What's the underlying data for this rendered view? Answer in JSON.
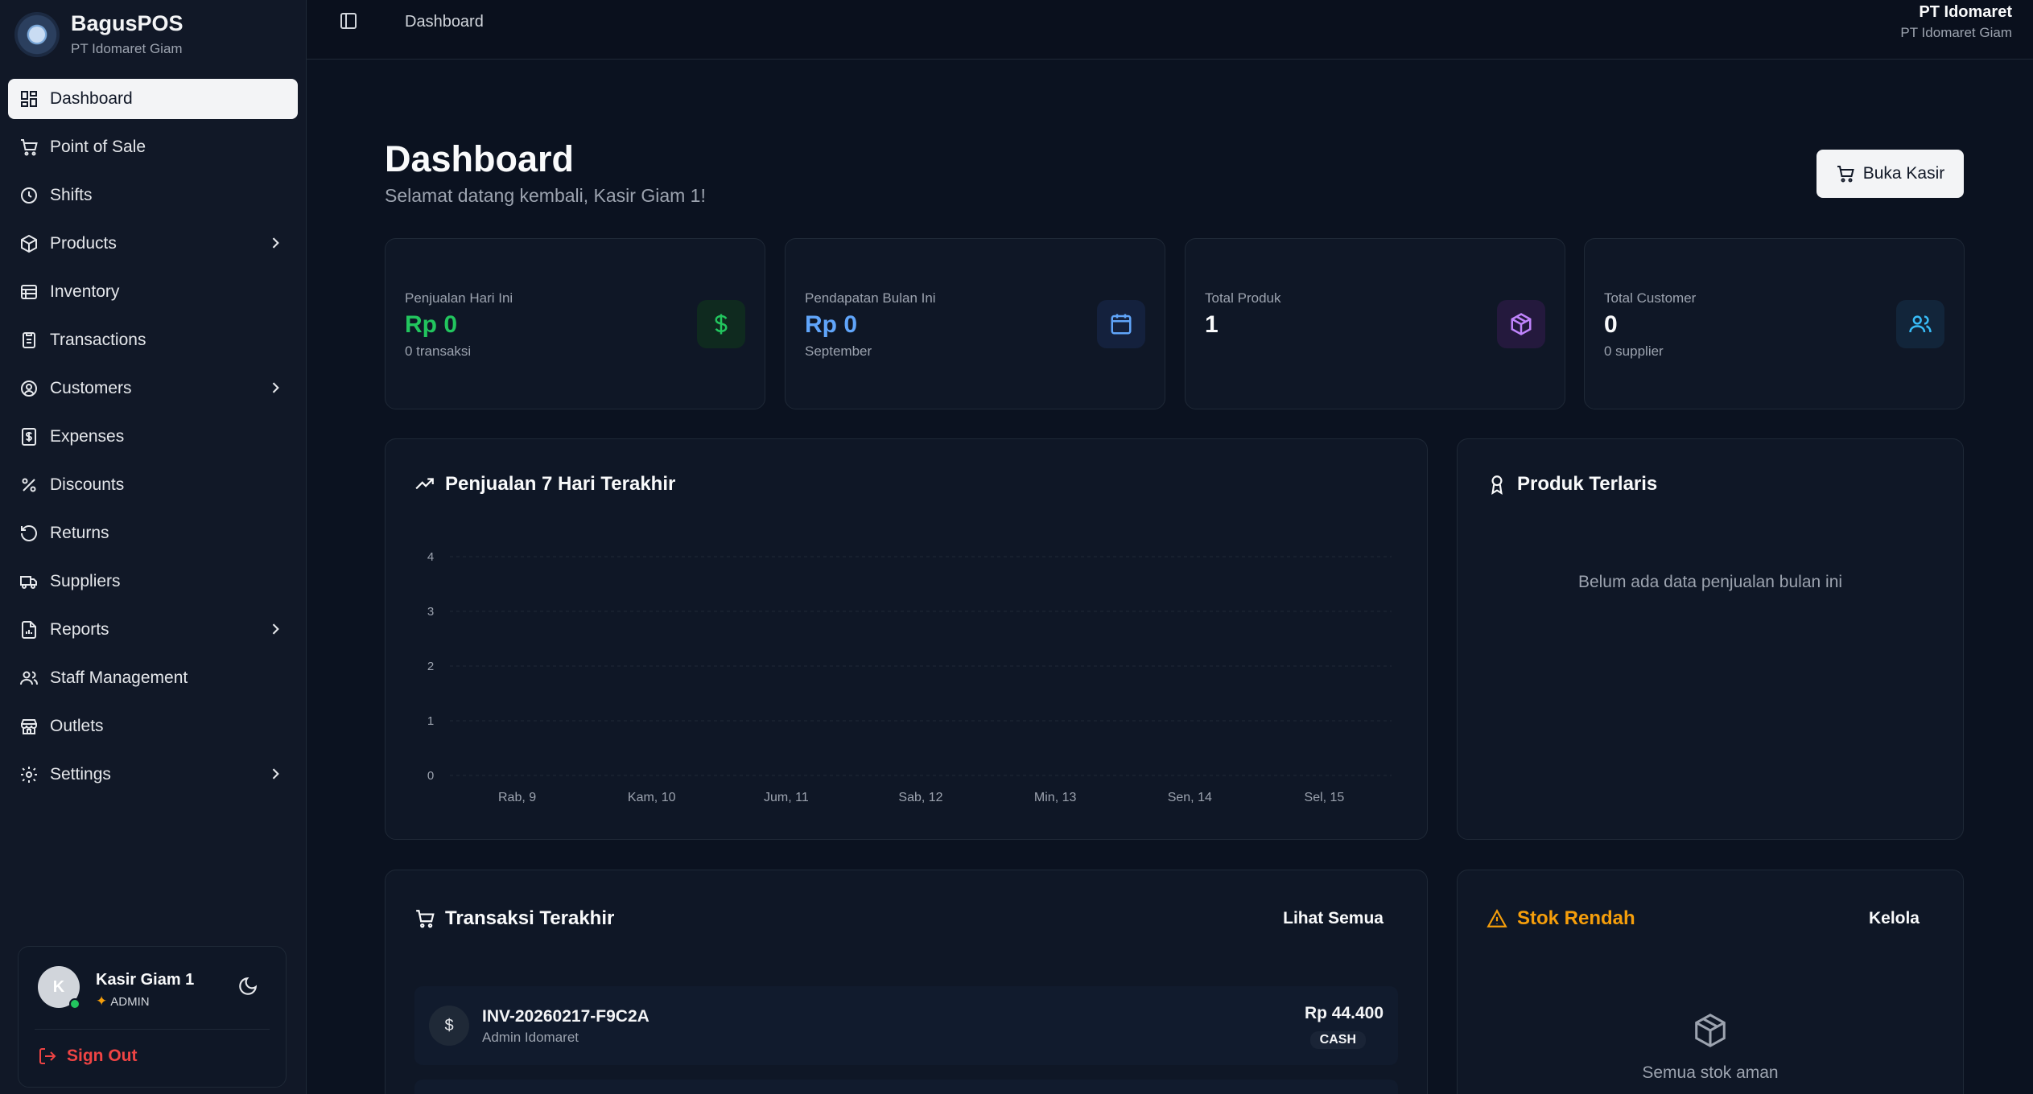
{
  "brand": {
    "name": "BagusPOS",
    "subtitle": "PT Idomaret Giam"
  },
  "sidebar": {
    "items": [
      {
        "label": "Dashboard",
        "icon": "dashboard-icon",
        "active": true
      },
      {
        "label": "Point of Sale",
        "icon": "cart-icon"
      },
      {
        "label": "Shifts",
        "icon": "clock-icon"
      },
      {
        "label": "Products",
        "icon": "box-icon",
        "expandable": true
      },
      {
        "label": "Inventory",
        "icon": "inventory-icon"
      },
      {
        "label": "Transactions",
        "icon": "receipt-icon"
      },
      {
        "label": "Customers",
        "icon": "user-circle-icon",
        "expandable": true
      },
      {
        "label": "Expenses",
        "icon": "expense-icon"
      },
      {
        "label": "Discounts",
        "icon": "percent-icon"
      },
      {
        "label": "Returns",
        "icon": "return-icon"
      },
      {
        "label": "Suppliers",
        "icon": "truck-icon"
      },
      {
        "label": "Reports",
        "icon": "report-icon",
        "expandable": true
      },
      {
        "label": "Staff Management",
        "icon": "users-icon"
      },
      {
        "label": "Outlets",
        "icon": "store-icon"
      },
      {
        "label": "Settings",
        "icon": "gear-icon",
        "expandable": true
      }
    ]
  },
  "user": {
    "initial": "K",
    "name": "Kasir Giam 1",
    "role": "ADMIN",
    "signout_label": "Sign Out"
  },
  "topbar": {
    "breadcrumb": "Dashboard",
    "org_name": "PT Idomaret",
    "org_sub": "PT Idomaret Giam"
  },
  "page": {
    "title": "Dashboard",
    "subtitle": "Selamat datang kembali, Kasir Giam 1!",
    "open_cashier_label": "Buka Kasir"
  },
  "stats": [
    {
      "label": "Penjualan Hari Ini",
      "value": "Rp 0",
      "sub": "0 transaksi",
      "value_color": "#22c55e",
      "icon": "dollar-icon",
      "icon_color": "#22c55e",
      "icon_bg": "#0f2a1f"
    },
    {
      "label": "Pendapatan Bulan Ini",
      "value": "Rp 0",
      "sub": "September",
      "value_color": "#60a5fa",
      "icon": "calendar-icon",
      "icon_color": "#60a5fa",
      "icon_bg": "#14213d"
    },
    {
      "label": "Total Produk",
      "value": "1",
      "sub": "",
      "value_color": "#f9fafb",
      "icon": "package-icon",
      "icon_color": "#c084fc",
      "icon_bg": "#24193d"
    },
    {
      "label": "Total Customer",
      "value": "0",
      "sub": "0 supplier",
      "value_color": "#f9fafb",
      "icon": "users-icon",
      "icon_color": "#38bdf8",
      "icon_bg": "#12253a"
    }
  ],
  "sales_chart": {
    "title": "Penjualan 7 Hari Terakhir"
  },
  "chart_data": {
    "type": "line",
    "title": "Penjualan 7 Hari Terakhir",
    "categories": [
      "Rab, 9",
      "Kam, 10",
      "Jum, 11",
      "Sab, 12",
      "Min, 13",
      "Sen, 14",
      "Sel, 15"
    ],
    "series": [
      {
        "values": [
          0,
          0,
          0,
          0,
          0,
          0,
          0
        ]
      }
    ],
    "y_ticks": [
      "0",
      "1",
      "2",
      "3",
      "4"
    ],
    "ylim": [
      0,
      4
    ],
    "grid": true
  },
  "best_sellers": {
    "title": "Produk Terlaris",
    "empty": "Belum ada data penjualan bulan ini"
  },
  "recent_transactions": {
    "title": "Transaksi Terakhir",
    "link": "Lihat Semua",
    "rows": [
      {
        "icon": "$",
        "id": "INV-20260217-F9C2A",
        "user": "Admin Idomaret",
        "amount": "Rp 44.400",
        "method": "CASH"
      }
    ]
  },
  "low_stock": {
    "title": "Stok Rendah",
    "link": "Kelola",
    "empty": "Semua stok aman"
  }
}
